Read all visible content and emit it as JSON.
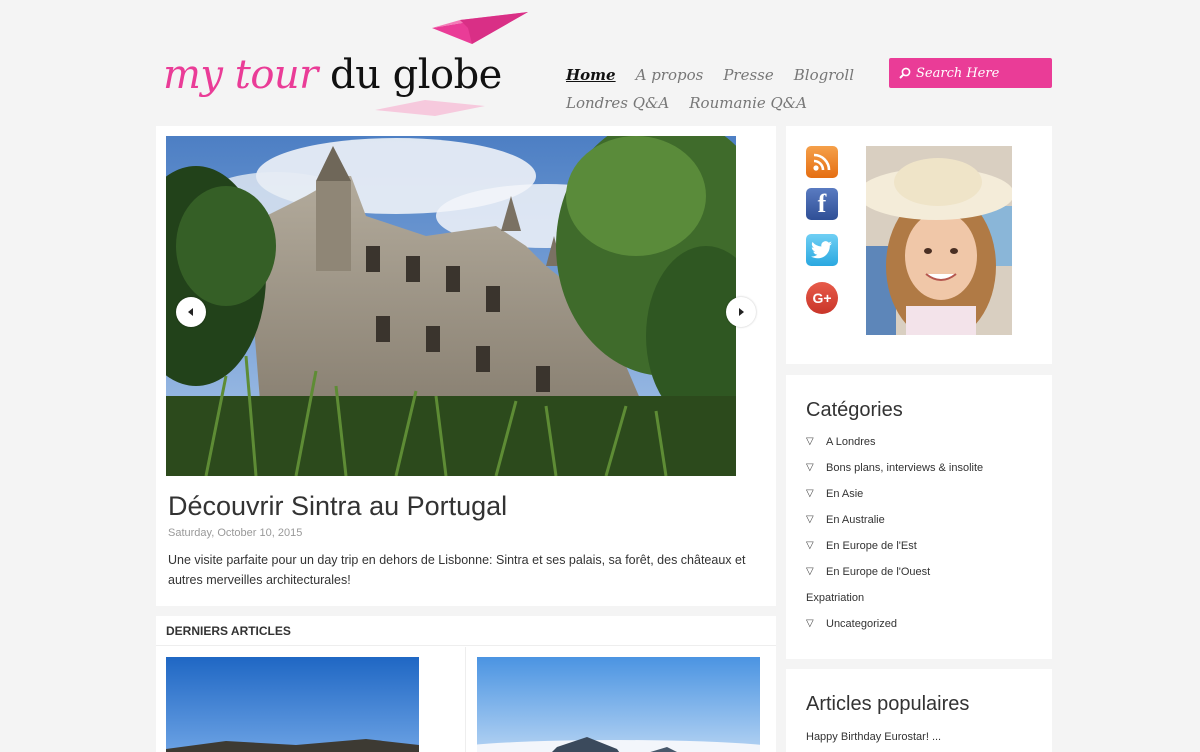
{
  "header": {
    "logo_part1": "my tour",
    "logo_part2": "du globe",
    "colors": {
      "accent": "#ea3c97",
      "background": "#f4f4f4"
    }
  },
  "nav": {
    "items": [
      "Home",
      "A propos",
      "Presse",
      "Blogroll",
      "Londres Q&A",
      "Roumanie Q&A"
    ],
    "active": "Home"
  },
  "search": {
    "placeholder": "Search Here",
    "icon": "search-icon"
  },
  "featured": {
    "title": "Découvrir Sintra au Portugal",
    "date": "Saturday, October 10, 2015",
    "excerpt": "Une visite parfaite pour un day trip en dehors de Lisbonne: Sintra et ses palais, sa forêt, des châteaux et autres merveilles architecturales!",
    "prev_icon": "chevron-left-icon",
    "next_icon": "chevron-right-icon"
  },
  "recent": {
    "heading": "DERNIERS ARTICLES"
  },
  "sidebar": {
    "social_icons": [
      "rss-icon",
      "facebook-icon",
      "twitter-icon",
      "google-plus-icon"
    ],
    "social_labels": {
      "facebook": "f",
      "google_plus": "G+"
    },
    "categories": {
      "title": "Catégories",
      "items": [
        {
          "label": "A Londres",
          "bullet": true
        },
        {
          "label": "Bons plans, interviews & insolite",
          "bullet": true
        },
        {
          "label": "En Asie",
          "bullet": true
        },
        {
          "label": "En Australie",
          "bullet": true
        },
        {
          "label": "En Europe de l'Est",
          "bullet": true
        },
        {
          "label": "En Europe de l'Ouest",
          "bullet": true
        },
        {
          "label": "Expatriation",
          "bullet": false
        },
        {
          "label": "Uncategorized",
          "bullet": true
        }
      ]
    },
    "popular": {
      "title": "Articles populaires",
      "items": [
        "Happy Birthday Eurostar! ..."
      ]
    }
  }
}
